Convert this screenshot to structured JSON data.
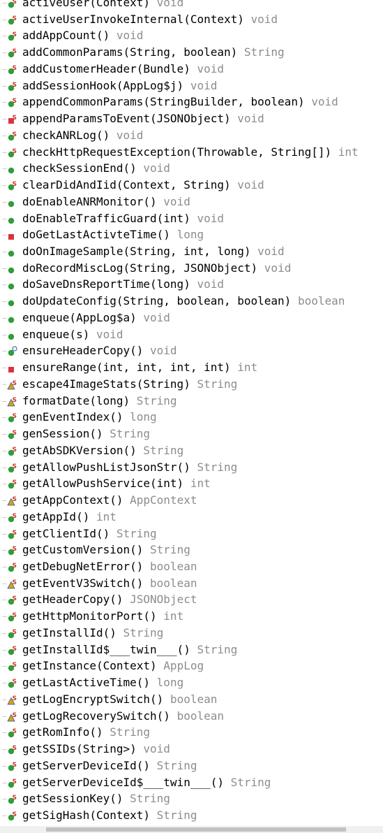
{
  "colors": {
    "public_method": "#2e9e37",
    "private_method": "#d9333f",
    "protected_method": "#d9a400",
    "static_marker": "#c0392b",
    "return_type": "#8c8c8c"
  },
  "methods": [
    {
      "name": "activeUser(Context)",
      "ret": "void",
      "icon": "public-static-method-icon"
    },
    {
      "name": "activeUserInvokeInternal(Context)",
      "ret": "void",
      "icon": "public-static-method-icon"
    },
    {
      "name": "addAppCount()",
      "ret": "void",
      "icon": "public-static-method-icon"
    },
    {
      "name": "addCommonParams(String, boolean)",
      "ret": "String",
      "icon": "public-static-method-icon"
    },
    {
      "name": "addCustomerHeader(Bundle)",
      "ret": "void",
      "icon": "public-static-method-icon"
    },
    {
      "name": "addSessionHook(AppLog$j)",
      "ret": "void",
      "icon": "public-static-method-icon"
    },
    {
      "name": "appendCommonParams(StringBuilder, boolean)",
      "ret": "void",
      "icon": "public-static-method-icon"
    },
    {
      "name": "appendParamsToEvent(JSONObject)",
      "ret": "void",
      "icon": "private-static-method-icon"
    },
    {
      "name": "checkANRLog()",
      "ret": "void",
      "icon": "public-static-method-icon"
    },
    {
      "name": "checkHttpRequestException(Throwable, String[])",
      "ret": "int",
      "icon": "public-static-method-icon"
    },
    {
      "name": "checkSessionEnd()",
      "ret": "void",
      "icon": "public-method-icon"
    },
    {
      "name": "clearDidAndIid(Context, String)",
      "ret": "void",
      "icon": "public-static-method-icon"
    },
    {
      "name": "doEnableANRMonitor()",
      "ret": "void",
      "icon": "public-method-icon"
    },
    {
      "name": "doEnableTrafficGuard(int)",
      "ret": "void",
      "icon": "public-method-icon"
    },
    {
      "name": "doGetLastActivteTime()",
      "ret": "long",
      "icon": "private-method-icon"
    },
    {
      "name": "doOnImageSample(String, int, long)",
      "ret": "void",
      "icon": "public-method-icon"
    },
    {
      "name": "doRecordMiscLog(String, JSONObject)",
      "ret": "void",
      "icon": "public-method-icon"
    },
    {
      "name": "doSaveDnsReportTime(long)",
      "ret": "void",
      "icon": "public-method-icon"
    },
    {
      "name": "doUpdateConfig(String, boolean, boolean)",
      "ret": "boolean",
      "icon": "public-method-icon"
    },
    {
      "name": "enqueue(AppLog$a)",
      "ret": "void",
      "icon": "public-method-icon"
    },
    {
      "name": "enqueue(s)",
      "ret": "void",
      "icon": "public-method-icon"
    },
    {
      "name": "ensureHeaderCopy()",
      "ret": "void",
      "icon": "public-synchronized-method-icon"
    },
    {
      "name": "ensureRange(int, int, int, int)",
      "ret": "int",
      "icon": "private-method-icon"
    },
    {
      "name": "escape4ImageStats(String)",
      "ret": "String",
      "icon": "protected-static-method-icon"
    },
    {
      "name": "formatDate(long)",
      "ret": "String",
      "icon": "protected-static-method-icon"
    },
    {
      "name": "genEventIndex()",
      "ret": "long",
      "icon": "public-static-method-icon"
    },
    {
      "name": "genSession()",
      "ret": "String",
      "icon": "public-static-method-icon"
    },
    {
      "name": "getAbSDKVersion()",
      "ret": "String",
      "icon": "public-static-method-icon"
    },
    {
      "name": "getAllowPushListJsonStr()",
      "ret": "String",
      "icon": "public-static-method-icon"
    },
    {
      "name": "getAllowPushService(int)",
      "ret": "int",
      "icon": "public-static-method-icon"
    },
    {
      "name": "getAppContext()",
      "ret": "AppContext",
      "icon": "protected-static-method-icon"
    },
    {
      "name": "getAppId()",
      "ret": "int",
      "icon": "public-static-method-icon"
    },
    {
      "name": "getClientId()",
      "ret": "String",
      "icon": "public-static-method-icon"
    },
    {
      "name": "getCustomVersion()",
      "ret": "String",
      "icon": "public-static-method-icon"
    },
    {
      "name": "getDebugNetError()",
      "ret": "boolean",
      "icon": "public-static-method-icon"
    },
    {
      "name": "getEventV3Switch()",
      "ret": "boolean",
      "icon": "protected-static-method-icon"
    },
    {
      "name": "getHeaderCopy()",
      "ret": "JSONObject",
      "icon": "public-static-method-icon"
    },
    {
      "name": "getHttpMonitorPort()",
      "ret": "int",
      "icon": "public-static-method-icon"
    },
    {
      "name": "getInstallId()",
      "ret": "String",
      "icon": "public-static-method-icon"
    },
    {
      "name": "getInstallId$___twin___()",
      "ret": "String",
      "icon": "public-static-method-icon"
    },
    {
      "name": "getInstance(Context)",
      "ret": "AppLog",
      "icon": "public-static-method-icon"
    },
    {
      "name": "getLastActiveTime()",
      "ret": "long",
      "icon": "public-static-method-icon"
    },
    {
      "name": "getLogEncryptSwitch()",
      "ret": "boolean",
      "icon": "protected-static-method-icon"
    },
    {
      "name": "getLogRecoverySwitch()",
      "ret": "boolean",
      "icon": "protected-static-method-icon"
    },
    {
      "name": "getRomInfo()",
      "ret": "String",
      "icon": "public-static-method-icon"
    },
    {
      "name": "getSSIDs(String>)",
      "ret": "void",
      "icon": "public-static-method-icon"
    },
    {
      "name": "getServerDeviceId()",
      "ret": "String",
      "icon": "public-static-method-icon"
    },
    {
      "name": "getServerDeviceId$___twin___()",
      "ret": "String",
      "icon": "public-static-method-icon"
    },
    {
      "name": "getSessionKey()",
      "ret": "String",
      "icon": "public-static-method-icon"
    },
    {
      "name": "getSigHash(Context)",
      "ret": "String",
      "icon": "public-static-method-icon"
    }
  ]
}
